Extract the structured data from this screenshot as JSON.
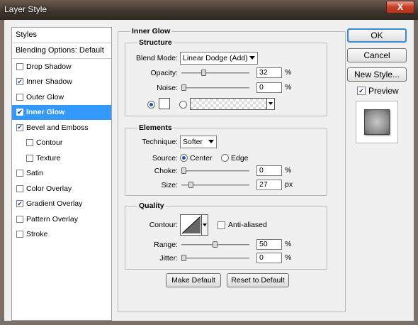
{
  "window": {
    "title": "Layer Style",
    "close_glyph": "X"
  },
  "sidebar": {
    "header": "Styles",
    "blending": "Blending Options: Default",
    "items": [
      {
        "label": "Drop Shadow",
        "checked": false
      },
      {
        "label": "Inner Shadow",
        "checked": true
      },
      {
        "label": "Outer Glow",
        "checked": false
      },
      {
        "label": "Inner Glow",
        "checked": true,
        "selected": true
      },
      {
        "label": "Bevel and Emboss",
        "checked": true
      },
      {
        "label": "Contour",
        "checked": false,
        "sub": true
      },
      {
        "label": "Texture",
        "checked": false,
        "sub": true
      },
      {
        "label": "Satin",
        "checked": false
      },
      {
        "label": "Color Overlay",
        "checked": false
      },
      {
        "label": "Gradient Overlay",
        "checked": true
      },
      {
        "label": "Pattern Overlay",
        "checked": false
      },
      {
        "label": "Stroke",
        "checked": false
      }
    ]
  },
  "panel": {
    "title": "Inner Glow",
    "structure": {
      "title": "Structure",
      "blend_mode_label": "Blend Mode:",
      "blend_mode_value": "Linear Dodge (Add)",
      "opacity_label": "Opacity:",
      "opacity_value": "32",
      "opacity_level": 32,
      "noise_label": "Noise:",
      "noise_value": "0",
      "noise_level": 0,
      "percent": "%",
      "color_selected": "solid",
      "swatch_color": "#ffffff"
    },
    "elements": {
      "title": "Elements",
      "technique_label": "Technique:",
      "technique_value": "Softer",
      "source_label": "Source:",
      "source_center": "Center",
      "source_edge": "Edge",
      "source_selected": "Center",
      "choke_label": "Choke:",
      "choke_value": "0",
      "choke_level": 0,
      "size_label": "Size:",
      "size_value": "27",
      "size_level": 11,
      "percent": "%",
      "px": "px"
    },
    "quality": {
      "title": "Quality",
      "contour_label": "Contour:",
      "antialiased_label": "Anti-aliased",
      "antialiased": false,
      "range_label": "Range:",
      "range_value": "50",
      "range_level": 50,
      "jitter_label": "Jitter:",
      "jitter_value": "0",
      "jitter_level": 0,
      "percent": "%"
    },
    "make_default": "Make Default",
    "reset_default": "Reset to Default"
  },
  "actions": {
    "ok": "OK",
    "cancel": "Cancel",
    "new_style": "New Style...",
    "preview_label": "Preview",
    "preview_checked": true
  }
}
